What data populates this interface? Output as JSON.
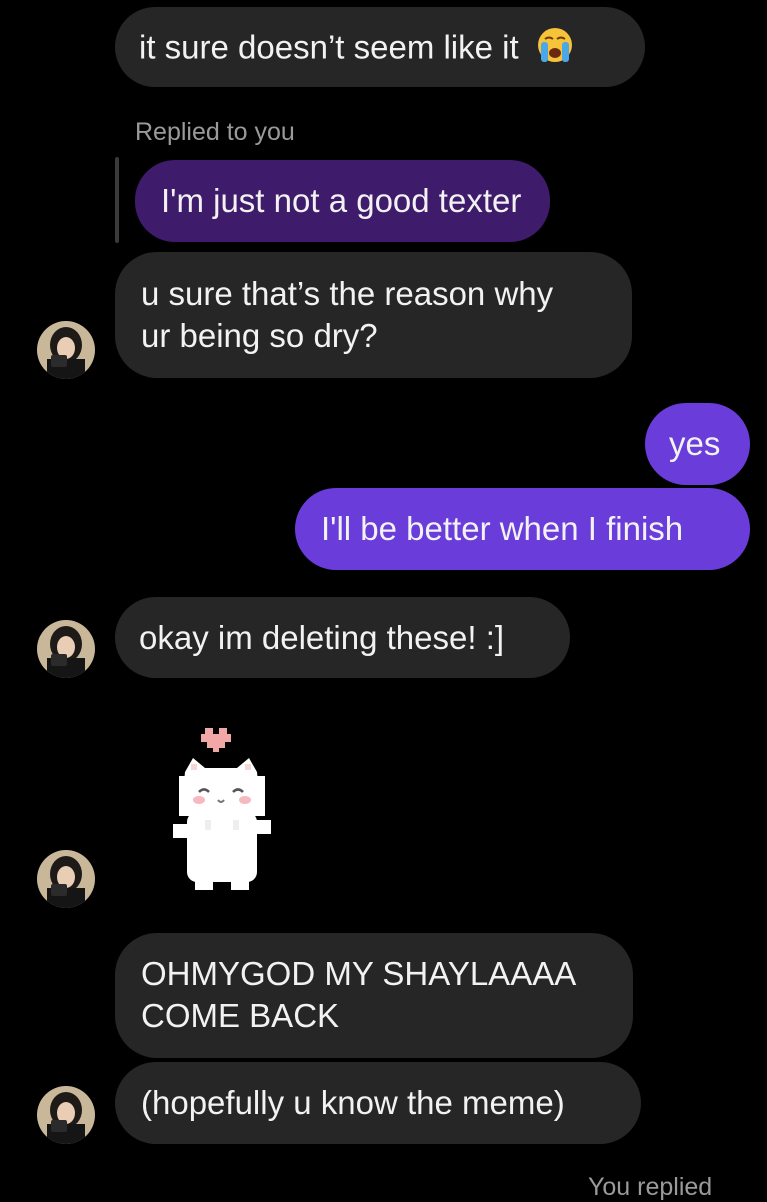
{
  "messages": {
    "m1": "it sure doesn’t seem like it",
    "m1_emoji": "loudly-crying-face-emoji",
    "reply_label": "Replied to you",
    "quoted": "I'm just not a good texter",
    "m2_line1": "u sure that’s the reason why",
    "m2_line2": "ur being so dry?",
    "s1": "yes",
    "s2": "I'll be better when I finish",
    "m3": "okay im deleting these! :]",
    "sticker": "white-cat-sticker-with-heart",
    "m4_line1": "OHMYGOD MY SHAYLAAAA",
    "m4_line2": "COME BACK",
    "m5": "(hopefully u know the meme)",
    "footer": "You replied"
  },
  "colors": {
    "background": "#000000",
    "received_bubble": "#262626",
    "sent_bubble": "#6a3ddb",
    "quoted_bubble": "#3f1b6b"
  }
}
